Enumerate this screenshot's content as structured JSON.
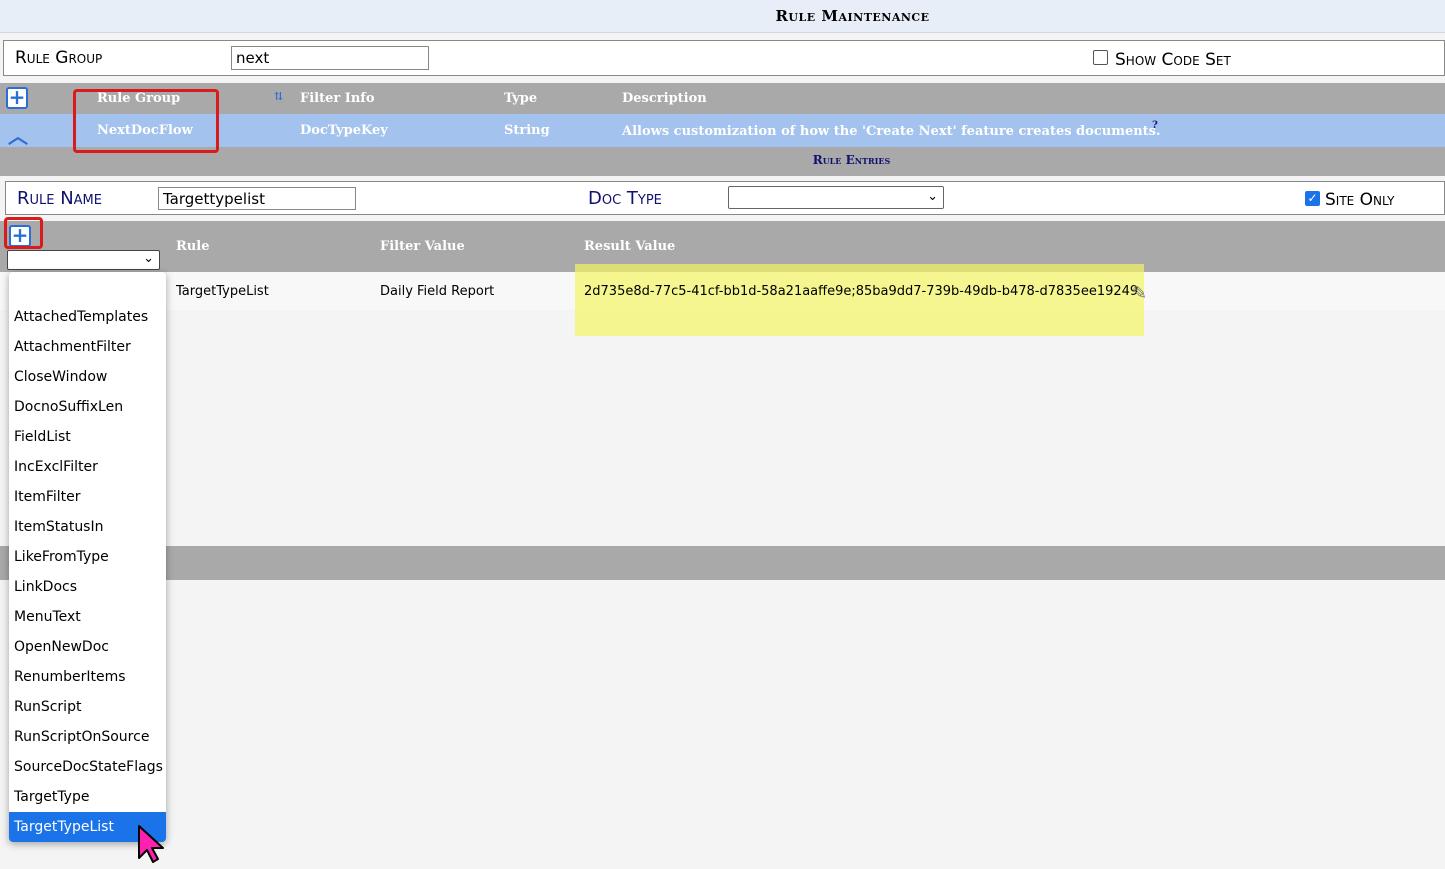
{
  "page_title": "Rule Maintenance",
  "rule_group": {
    "label": "Rule Group",
    "value": "next",
    "show_code_set_label": "Show Code Set",
    "show_code_set_checked": false
  },
  "group_table": {
    "headers": [
      "Rule Group",
      "Filter Info",
      "Type",
      "Description"
    ],
    "selected_row": {
      "rule_group": "NextDocFlow",
      "filter_info": "DocTypeKey",
      "type": "String",
      "description": "Allows customization of how the 'Create Next' feature creates documents.",
      "help": "?"
    }
  },
  "rule_entries_title": "Rule Entries",
  "rule_name": {
    "label": "Rule Name",
    "value": "Targettypelist",
    "doc_type_label": "Doc Type",
    "doc_type_value": "",
    "site_only_label": "Site Only",
    "site_only_checked": true
  },
  "entries_table": {
    "headers": [
      "Rule",
      "Filter Value",
      "Result Value"
    ],
    "rows": [
      {
        "rule": "TargetTypeList",
        "filter_value": "Daily Field Report",
        "result_value": "2d735e8d-77c5-41cf-bb1d-58a21aaffe9e;85ba9dd7-739b-49db-b478-d7835ee19249"
      }
    ]
  },
  "rule_dropdown": {
    "selected": "TargetTypeList",
    "options": [
      "",
      "AttachedTemplates",
      "AttachmentFilter",
      "CloseWindow",
      "DocnoSuffixLen",
      "FieldList",
      "IncExclFilter",
      "ItemFilter",
      "ItemStatusIn",
      "LikeFromType",
      "LinkDocs",
      "MenuText",
      "OpenNewDoc",
      "RenumberItems",
      "RunScript",
      "RunScriptOnSource",
      "SourceDocStateFlags",
      "TargetType",
      "TargetTypeList"
    ]
  },
  "colors": {
    "header_grey": "#a9a9a9",
    "selected_row": "#a4c2ee",
    "highlight": "#f5f564",
    "annotation_red": "#d81c1c",
    "accent_blue": "#1a73e8"
  },
  "icons": {
    "add": "plus-icon",
    "collapse": "caret-up-icon",
    "sort": "sort-icon",
    "edit": "pencil-icon",
    "pointer": "mouse-cursor-icon"
  }
}
